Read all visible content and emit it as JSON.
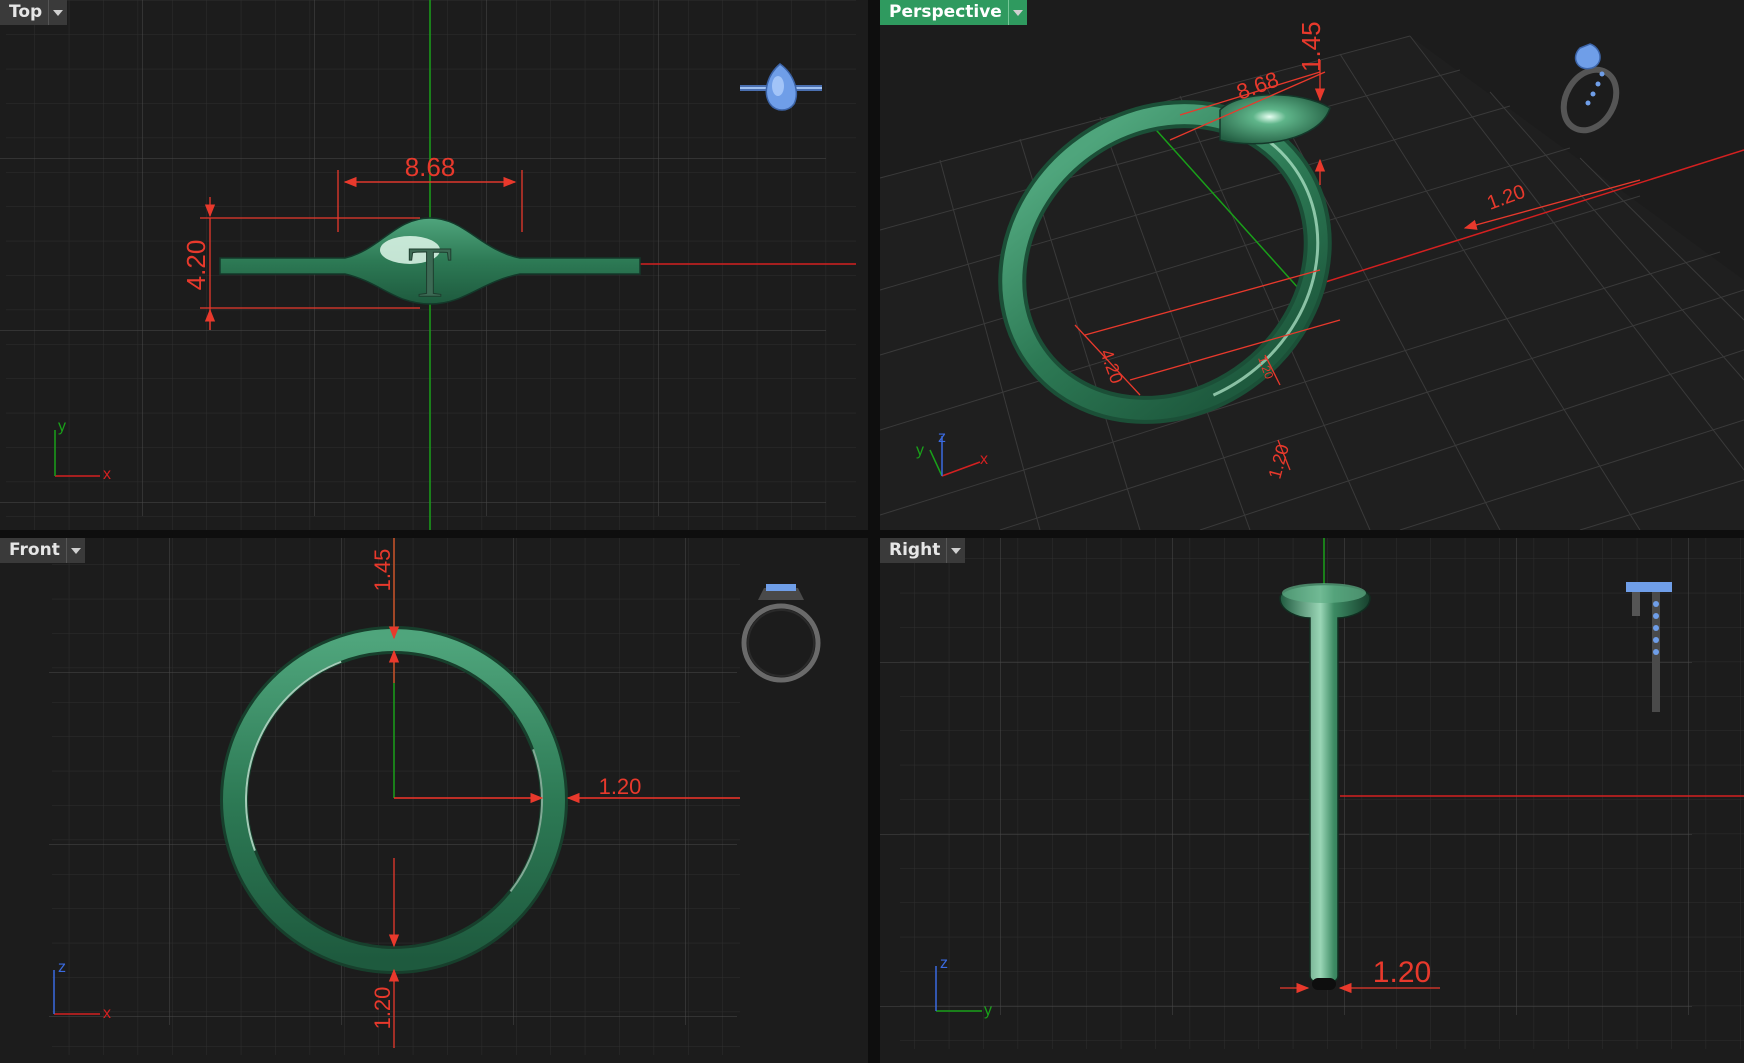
{
  "viewports": {
    "top": {
      "label": "Top",
      "dimensions": {
        "width": "8.68",
        "height": "4.20"
      },
      "axes": {
        "x": "x",
        "y": "y"
      },
      "engraving": "T"
    },
    "perspective": {
      "label": "Perspective",
      "dimensions": {
        "top_width": "8.68",
        "top_height": "1.45",
        "side": "1.20",
        "bottom_a": "4.20",
        "bottom_b": "1.20",
        "bottom_c": "1.20"
      },
      "axes": {
        "x": "x",
        "y": "y",
        "z": "z"
      }
    },
    "front": {
      "label": "Front",
      "dimensions": {
        "top": "1.45",
        "right": "1.20",
        "bottom": "1.20"
      },
      "axes": {
        "x": "x",
        "z": "z"
      }
    },
    "right": {
      "label": "Right",
      "dimensions": {
        "bottom": "1.20"
      },
      "axes": {
        "y": "y",
        "z": "z"
      }
    }
  },
  "colors": {
    "background": "#1c1c1c",
    "grid": "#3c3c3c",
    "ring": "#2f7a55",
    "dimension": "#e8392c",
    "gem": "#6f9ee8",
    "active_tab": "#2f9a5f"
  },
  "icons": [
    "dropdown-arrow-icon",
    "ring-preview-icon",
    "axis-gizmo-icon"
  ]
}
